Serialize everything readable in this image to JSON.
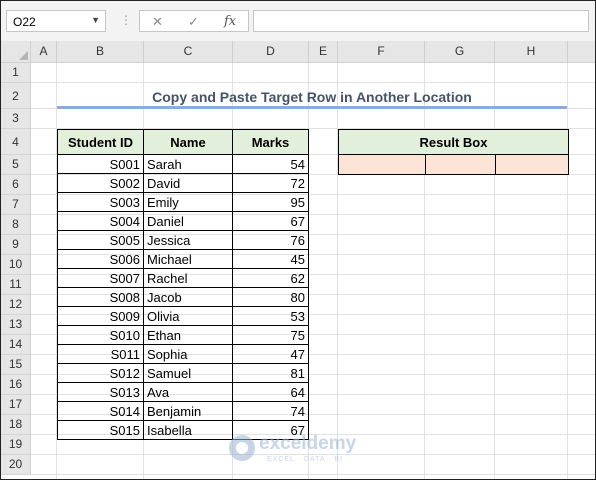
{
  "formula_bar": {
    "name_box": "O22",
    "cancel_icon": "✕",
    "enter_icon": "✓",
    "fx_label": "fx",
    "formula": ""
  },
  "columns": [
    "A",
    "B",
    "C",
    "D",
    "E",
    "F",
    "G",
    "H"
  ],
  "rows": [
    "1",
    "2",
    "3",
    "4",
    "5",
    "6",
    "7",
    "8",
    "9",
    "10",
    "11",
    "12",
    "13",
    "14",
    "15",
    "16",
    "17",
    "18",
    "19",
    "20"
  ],
  "title": "Copy and Paste Target Row in Another Location",
  "table": {
    "headers": [
      "Student ID",
      "Name",
      "Marks"
    ],
    "rows": [
      {
        "id": "S001",
        "name": "Sarah",
        "marks": "54"
      },
      {
        "id": "S002",
        "name": "David",
        "marks": "72"
      },
      {
        "id": "S003",
        "name": "Emily",
        "marks": "95"
      },
      {
        "id": "S004",
        "name": "Daniel",
        "marks": "67"
      },
      {
        "id": "S005",
        "name": "Jessica",
        "marks": "76"
      },
      {
        "id": "S006",
        "name": "Michael",
        "marks": "45"
      },
      {
        "id": "S007",
        "name": "Rachel",
        "marks": "62"
      },
      {
        "id": "S008",
        "name": "Jacob",
        "marks": "80"
      },
      {
        "id": "S009",
        "name": "Olivia",
        "marks": "53"
      },
      {
        "id": "S010",
        "name": "Ethan",
        "marks": "75"
      },
      {
        "id": "S011",
        "name": "Sophia",
        "marks": "47"
      },
      {
        "id": "S012",
        "name": "Samuel",
        "marks": "81"
      },
      {
        "id": "S013",
        "name": "Ava",
        "marks": "64"
      },
      {
        "id": "S014",
        "name": "Benjamin",
        "marks": "74"
      },
      {
        "id": "S015",
        "name": "Isabella",
        "marks": "67"
      }
    ]
  },
  "result_box": {
    "header": "Result Box",
    "cells": [
      "",
      "",
      ""
    ]
  },
  "watermark": {
    "name": "exceldemy",
    "tagline": "EXCEL · DATA · BI"
  },
  "colors": {
    "header_fill": "#e2efda",
    "result_fill": "#fce4d6",
    "title_color": "#44546a",
    "title_rule": "#8ea9db"
  }
}
